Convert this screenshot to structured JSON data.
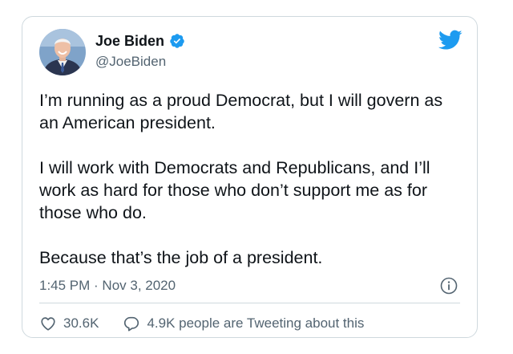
{
  "author": {
    "display_name": "Joe Biden",
    "handle": "@JoeBiden",
    "verified_icon": "verified-badge-icon",
    "avatar_icon": "profile-photo"
  },
  "brand_icon": "twitter-bird-icon",
  "tweet": {
    "text": "I’m running as a proud Democrat, but I will govern as an American president.\n\nI will work with Democrats and Republicans, and I’ll work as hard for those who don’t support me as for those who do.\n\nBecause that’s the job of a president.",
    "timestamp": "1:45 PM · Nov 3, 2020"
  },
  "actions": {
    "likes": "30.6K",
    "conversation": "4.9K people are Tweeting about this"
  },
  "colors": {
    "twitter_blue": "#1d9bf0",
    "text_primary": "#0f1419",
    "text_secondary": "#536471",
    "border": "#cfd9de"
  }
}
